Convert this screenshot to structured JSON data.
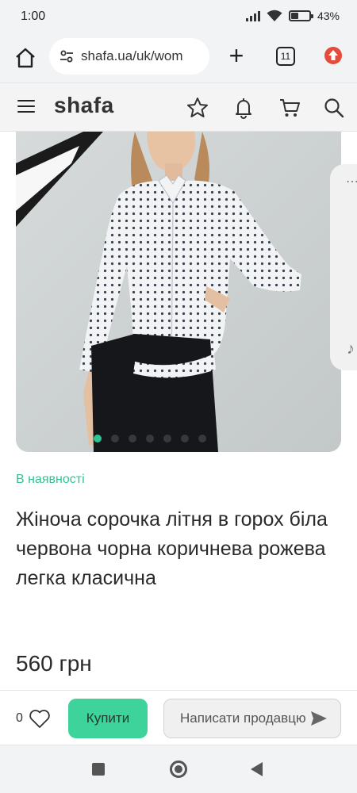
{
  "status": {
    "time": "1:00",
    "battery": "43%",
    "battery_level": 0.43
  },
  "browser": {
    "url": "shafa.ua/uk/wom",
    "tab_count": "11"
  },
  "site": {
    "logo": "shafa"
  },
  "gallery": {
    "dot_count": 7,
    "active_index": 0
  },
  "product": {
    "availability": "В наявності",
    "title": "Жіноча сорочка літня в горох біла червона чорна коричнева рожева легка класична",
    "price": "560 грн"
  },
  "actions": {
    "likes": "0",
    "buy_label": "Купити",
    "message_label": "Написати продавцю"
  },
  "colors": {
    "accent": "#3ed39b",
    "availability": "#34c38f",
    "active_dot": "#2fc592"
  },
  "icons": [
    "home-icon",
    "site-settings-icon",
    "plus-icon",
    "tabs-icon",
    "update-icon",
    "menu-icon",
    "star-icon",
    "bell-icon",
    "cart-icon",
    "search-icon",
    "heart-icon",
    "send-icon",
    "more-icon",
    "music-icon"
  ]
}
